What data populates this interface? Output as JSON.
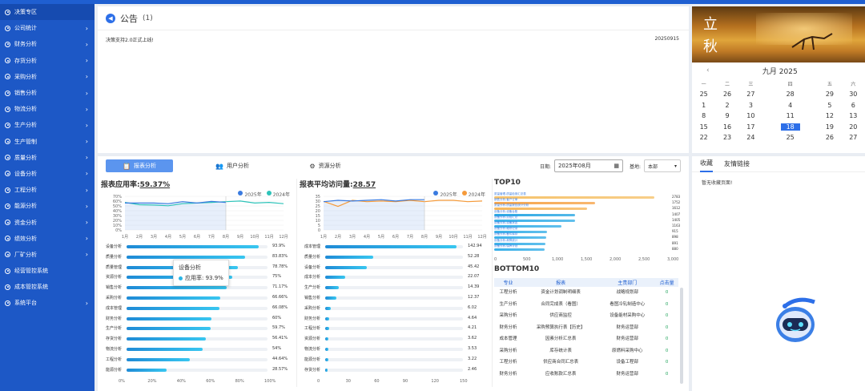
{
  "sidebar": {
    "items": [
      {
        "label": "决策专区",
        "arrow": false
      },
      {
        "label": "公司统计",
        "arrow": true
      },
      {
        "label": "财务分析",
        "arrow": true
      },
      {
        "label": "存货分析",
        "arrow": true
      },
      {
        "label": "采购分析",
        "arrow": true
      },
      {
        "label": "销售分析",
        "arrow": true
      },
      {
        "label": "物流分析",
        "arrow": true
      },
      {
        "label": "生产分析",
        "arrow": true
      },
      {
        "label": "生产管制",
        "arrow": true
      },
      {
        "label": "质量分析",
        "arrow": true
      },
      {
        "label": "设备分析",
        "arrow": true
      },
      {
        "label": "工程分析",
        "arrow": true
      },
      {
        "label": "能源分析",
        "arrow": true
      },
      {
        "label": "资金分析",
        "arrow": true
      },
      {
        "label": "绩效分析",
        "arrow": true
      },
      {
        "label": "厂矿分析",
        "arrow": true
      },
      {
        "label": "经营管控系统",
        "arrow": false
      },
      {
        "label": "成本管控系统",
        "arrow": false
      },
      {
        "label": "系统平台",
        "arrow": true
      }
    ]
  },
  "notice": {
    "title": "公告",
    "count": "(1)",
    "rows": [
      {
        "text": "决策支持2.0正式上线!",
        "date": "20250915"
      }
    ]
  },
  "calendar": {
    "chars": [
      "立",
      "秋"
    ],
    "month": "九月 2025",
    "prev": "‹",
    "weekdays": [
      "一",
      "二",
      "三",
      "四",
      "五",
      "六"
    ],
    "weeks": [
      [
        "25",
        "26",
        "27",
        "28",
        "29",
        "30"
      ],
      [
        "1",
        "2",
        "3",
        "4",
        "5",
        "6"
      ],
      [
        "8",
        "9",
        "10",
        "11",
        "12",
        "13"
      ],
      [
        "15",
        "16",
        "17",
        "18",
        "19",
        "20"
      ],
      [
        "22",
        "23",
        "24",
        "25",
        "26",
        "27"
      ]
    ],
    "today": "18"
  },
  "analysis": {
    "tabs": [
      {
        "label": "报表分析",
        "icon": "📋"
      },
      {
        "label": "用户分析",
        "icon": "👥"
      },
      {
        "label": "资源分析",
        "icon": "⚙"
      }
    ],
    "date_label": "日期:",
    "date_value": "2025年08月",
    "base_label": "基地:",
    "base_value": "本部"
  },
  "usage": {
    "title_prefix": "报表应用率:",
    "title_value": "59.37%",
    "legend": [
      "2025年",
      "2024年"
    ],
    "months": [
      "1月",
      "2月",
      "3月",
      "4月",
      "5月",
      "6月",
      "7月",
      "8月",
      "9月",
      "10月",
      "11月",
      "12月"
    ],
    "yticks": [
      "70%",
      "60%",
      "50%",
      "40%",
      "30%",
      "20%",
      "10%",
      "0%"
    ],
    "bars": [
      {
        "label": "设备分析",
        "value": 93.9,
        "text": "93.9%"
      },
      {
        "label": "质量分析",
        "value": 83.83,
        "text": "83.83%"
      },
      {
        "label": "质量管理",
        "value": 78.78,
        "text": "78.78%"
      },
      {
        "label": "资源分析",
        "value": 75,
        "text": "75%"
      },
      {
        "label": "销售分析",
        "value": 71.17,
        "text": "71.17%"
      },
      {
        "label": "采购分析",
        "value": 66.66,
        "text": "66.66%"
      },
      {
        "label": "成本管理",
        "value": 66.08,
        "text": "66.08%"
      },
      {
        "label": "财务分析",
        "value": 60,
        "text": "60%"
      },
      {
        "label": "生产分析",
        "value": 59.7,
        "text": "59.7%"
      },
      {
        "label": "存货分析",
        "value": 56.41,
        "text": "56.41%"
      },
      {
        "label": "物流分析",
        "value": 54,
        "text": "54%"
      },
      {
        "label": "工程分析",
        "value": 44.64,
        "text": "44.64%"
      },
      {
        "label": "能源分析",
        "value": 28.57,
        "text": "28.57%"
      }
    ],
    "xticks": [
      "0%",
      "20%",
      "40%",
      "60%",
      "80%",
      "100%"
    ],
    "tooltip": {
      "title": "设备分析",
      "text": "应用率: 93.9%"
    }
  },
  "avgvisit": {
    "title_prefix": "报表平均访问量:",
    "title_value": "28.57",
    "legend": [
      "2025年",
      "2024年"
    ],
    "months": [
      "1月",
      "2月",
      "3月",
      "4月",
      "5月",
      "6月",
      "7月",
      "8月",
      "9月",
      "10月",
      "11月",
      "12月"
    ],
    "yticks": [
      "35",
      "30",
      "25",
      "20",
      "15",
      "10",
      "5",
      "0"
    ],
    "bars": [
      {
        "label": "成本管理",
        "value": 142.94,
        "text": "142.94"
      },
      {
        "label": "质量分析",
        "value": 52.28,
        "text": "52.28"
      },
      {
        "label": "设备分析",
        "value": 45.42,
        "text": "45.42"
      },
      {
        "label": "成本分析",
        "value": 22.07,
        "text": "22.07"
      },
      {
        "label": "生产分析",
        "value": 14.39,
        "text": "14.39"
      },
      {
        "label": "销售分析",
        "value": 12.37,
        "text": "12.37"
      },
      {
        "label": "采购分析",
        "value": 6.02,
        "text": "6.02"
      },
      {
        "label": "财务分析",
        "value": 4.64,
        "text": "4.64"
      },
      {
        "label": "工程分析",
        "value": 4.21,
        "text": "4.21"
      },
      {
        "label": "资源分析",
        "value": 3.62,
        "text": "3.62"
      },
      {
        "label": "物流分析",
        "value": 3.53,
        "text": "3.53"
      },
      {
        "label": "能源分析",
        "value": 3.22,
        "text": "3.22"
      },
      {
        "label": "存货分析",
        "value": 2.46,
        "text": "2.46"
      }
    ],
    "xticks": [
      "0",
      "30",
      "60",
      "90",
      "120",
      "150"
    ]
  },
  "top10": {
    "title": "TOP10",
    "rows": [
      {
        "label": "质量管理-质量检测汇总表",
        "value": 2783
      },
      {
        "label": "销售分析-客户订单",
        "value": 1752
      },
      {
        "label": "质量分析-质量报告统计分析",
        "value": 1612
      },
      {
        "label": "设备分析-设备台账",
        "value": 1407
      },
      {
        "label": "设备分析-点检汇总",
        "value": 1405
      },
      {
        "label": "设备分析-设备状态",
        "value": 1163
      },
      {
        "label": "设备分析-维修记录",
        "value": 915
      },
      {
        "label": "设备分析-备件库存",
        "value": 898
      },
      {
        "label": "设备分析-故障统计",
        "value": 891
      },
      {
        "label": "设备分析-保养计划",
        "value": 880
      }
    ],
    "xticks": [
      "0",
      "500",
      "1,000",
      "1,500",
      "2,000",
      "2,500",
      "3,000"
    ]
  },
  "bottom10": {
    "title": "BOTTOM10",
    "headers": [
      "专业",
      "报表",
      "主责部门",
      "点击量"
    ],
    "rows": [
      [
        "工程分析",
        "资金计划调制明细表",
        "战略规划部",
        "0"
      ],
      [
        "生产分析",
        "合同完成表（看图）",
        "看图冷轧制造中心",
        "0"
      ],
      [
        "采购分析",
        "供应商监控",
        "设备能材采购中心",
        "0"
      ],
      [
        "财务分析",
        "采购预算执行表【历史】",
        "财务运营部",
        "0"
      ],
      [
        "成本管理",
        "因素分析汇总表",
        "财务运营部",
        "0"
      ],
      [
        "采购分析",
        "库存统计表",
        "原燃料采购中心",
        "0"
      ],
      [
        "工程分析",
        "供应商合同汇总表",
        "设备工程部",
        "0"
      ],
      [
        "财务分析",
        "应收账款汇总表",
        "财务运营部",
        "0"
      ]
    ]
  },
  "favorites": {
    "tabs": [
      "收藏",
      "友情链接"
    ],
    "empty": "暂无收藏页面!"
  },
  "colors": {
    "primary": "#1d58c6",
    "s2025": "#3a7be0",
    "s2024": "#2ec3b9",
    "orange": "#f59a3a"
  }
}
